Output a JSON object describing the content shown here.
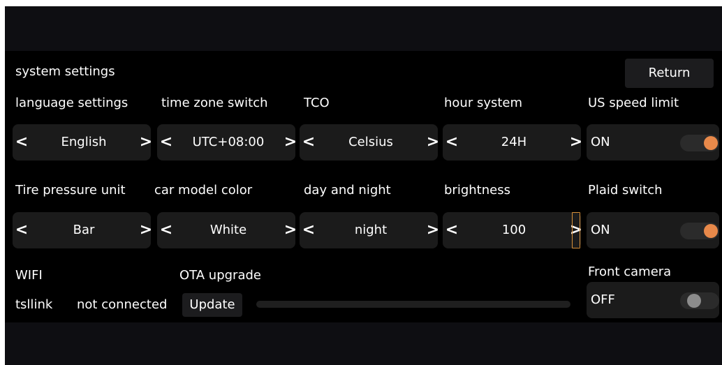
{
  "section_title": "system settings",
  "return_label": "Return",
  "row1": {
    "labels": [
      "language settings",
      "time zone switch",
      "TCO",
      "hour system",
      "US speed limit"
    ],
    "selectors": [
      {
        "value": "English",
        "prev": "<",
        "next": ">"
      },
      {
        "value": "UTC+08:00",
        "prev": "<",
        "next": ">"
      },
      {
        "value": "Celsius",
        "prev": "<",
        "next": ">"
      },
      {
        "value": "24H",
        "prev": "<",
        "next": ">"
      }
    ],
    "toggle": {
      "state": "ON",
      "on": true
    }
  },
  "row2": {
    "labels": [
      "Tire pressure unit",
      "car model color",
      "day and night",
      "brightness",
      "Plaid switch"
    ],
    "selectors": [
      {
        "value": "Bar",
        "prev": "<",
        "next": ">"
      },
      {
        "value": "White",
        "prev": "<",
        "next": ">"
      },
      {
        "value": "night",
        "prev": "<",
        "next": ">"
      },
      {
        "value": "100",
        "prev": "<",
        "next": ">"
      }
    ],
    "toggle": {
      "state": "ON",
      "on": true
    }
  },
  "wifi": {
    "label": "WIFI",
    "network": "tsllink",
    "status": "not connected"
  },
  "ota": {
    "label": "OTA upgrade",
    "update_label": "Update",
    "progress": 0
  },
  "front_camera": {
    "label": "Front camera",
    "state": "OFF",
    "on": false
  },
  "colors": {
    "accent": "#e8894a",
    "panel": "#000000",
    "control_bg": "#1b1b1b"
  },
  "icons": {
    "prev": "chevron-left-icon",
    "next": "chevron-right-icon"
  }
}
